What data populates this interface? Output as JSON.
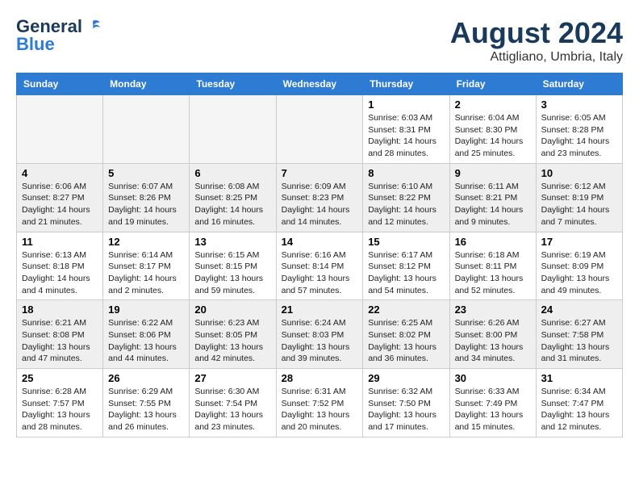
{
  "header": {
    "logo_general": "General",
    "logo_blue": "Blue",
    "month_title": "August 2024",
    "location": "Attigliano, Umbria, Italy"
  },
  "days_of_week": [
    "Sunday",
    "Monday",
    "Tuesday",
    "Wednesday",
    "Thursday",
    "Friday",
    "Saturday"
  ],
  "weeks": [
    {
      "shaded": false,
      "days": [
        {
          "num": "",
          "info": ""
        },
        {
          "num": "",
          "info": ""
        },
        {
          "num": "",
          "info": ""
        },
        {
          "num": "",
          "info": ""
        },
        {
          "num": "1",
          "info": "Sunrise: 6:03 AM\nSunset: 8:31 PM\nDaylight: 14 hours\nand 28 minutes."
        },
        {
          "num": "2",
          "info": "Sunrise: 6:04 AM\nSunset: 8:30 PM\nDaylight: 14 hours\nand 25 minutes."
        },
        {
          "num": "3",
          "info": "Sunrise: 6:05 AM\nSunset: 8:28 PM\nDaylight: 14 hours\nand 23 minutes."
        }
      ]
    },
    {
      "shaded": true,
      "days": [
        {
          "num": "4",
          "info": "Sunrise: 6:06 AM\nSunset: 8:27 PM\nDaylight: 14 hours\nand 21 minutes."
        },
        {
          "num": "5",
          "info": "Sunrise: 6:07 AM\nSunset: 8:26 PM\nDaylight: 14 hours\nand 19 minutes."
        },
        {
          "num": "6",
          "info": "Sunrise: 6:08 AM\nSunset: 8:25 PM\nDaylight: 14 hours\nand 16 minutes."
        },
        {
          "num": "7",
          "info": "Sunrise: 6:09 AM\nSunset: 8:23 PM\nDaylight: 14 hours\nand 14 minutes."
        },
        {
          "num": "8",
          "info": "Sunrise: 6:10 AM\nSunset: 8:22 PM\nDaylight: 14 hours\nand 12 minutes."
        },
        {
          "num": "9",
          "info": "Sunrise: 6:11 AM\nSunset: 8:21 PM\nDaylight: 14 hours\nand 9 minutes."
        },
        {
          "num": "10",
          "info": "Sunrise: 6:12 AM\nSunset: 8:19 PM\nDaylight: 14 hours\nand 7 minutes."
        }
      ]
    },
    {
      "shaded": false,
      "days": [
        {
          "num": "11",
          "info": "Sunrise: 6:13 AM\nSunset: 8:18 PM\nDaylight: 14 hours\nand 4 minutes."
        },
        {
          "num": "12",
          "info": "Sunrise: 6:14 AM\nSunset: 8:17 PM\nDaylight: 14 hours\nand 2 minutes."
        },
        {
          "num": "13",
          "info": "Sunrise: 6:15 AM\nSunset: 8:15 PM\nDaylight: 13 hours\nand 59 minutes."
        },
        {
          "num": "14",
          "info": "Sunrise: 6:16 AM\nSunset: 8:14 PM\nDaylight: 13 hours\nand 57 minutes."
        },
        {
          "num": "15",
          "info": "Sunrise: 6:17 AM\nSunset: 8:12 PM\nDaylight: 13 hours\nand 54 minutes."
        },
        {
          "num": "16",
          "info": "Sunrise: 6:18 AM\nSunset: 8:11 PM\nDaylight: 13 hours\nand 52 minutes."
        },
        {
          "num": "17",
          "info": "Sunrise: 6:19 AM\nSunset: 8:09 PM\nDaylight: 13 hours\nand 49 minutes."
        }
      ]
    },
    {
      "shaded": true,
      "days": [
        {
          "num": "18",
          "info": "Sunrise: 6:21 AM\nSunset: 8:08 PM\nDaylight: 13 hours\nand 47 minutes."
        },
        {
          "num": "19",
          "info": "Sunrise: 6:22 AM\nSunset: 8:06 PM\nDaylight: 13 hours\nand 44 minutes."
        },
        {
          "num": "20",
          "info": "Sunrise: 6:23 AM\nSunset: 8:05 PM\nDaylight: 13 hours\nand 42 minutes."
        },
        {
          "num": "21",
          "info": "Sunrise: 6:24 AM\nSunset: 8:03 PM\nDaylight: 13 hours\nand 39 minutes."
        },
        {
          "num": "22",
          "info": "Sunrise: 6:25 AM\nSunset: 8:02 PM\nDaylight: 13 hours\nand 36 minutes."
        },
        {
          "num": "23",
          "info": "Sunrise: 6:26 AM\nSunset: 8:00 PM\nDaylight: 13 hours\nand 34 minutes."
        },
        {
          "num": "24",
          "info": "Sunrise: 6:27 AM\nSunset: 7:58 PM\nDaylight: 13 hours\nand 31 minutes."
        }
      ]
    },
    {
      "shaded": false,
      "days": [
        {
          "num": "25",
          "info": "Sunrise: 6:28 AM\nSunset: 7:57 PM\nDaylight: 13 hours\nand 28 minutes."
        },
        {
          "num": "26",
          "info": "Sunrise: 6:29 AM\nSunset: 7:55 PM\nDaylight: 13 hours\nand 26 minutes."
        },
        {
          "num": "27",
          "info": "Sunrise: 6:30 AM\nSunset: 7:54 PM\nDaylight: 13 hours\nand 23 minutes."
        },
        {
          "num": "28",
          "info": "Sunrise: 6:31 AM\nSunset: 7:52 PM\nDaylight: 13 hours\nand 20 minutes."
        },
        {
          "num": "29",
          "info": "Sunrise: 6:32 AM\nSunset: 7:50 PM\nDaylight: 13 hours\nand 17 minutes."
        },
        {
          "num": "30",
          "info": "Sunrise: 6:33 AM\nSunset: 7:49 PM\nDaylight: 13 hours\nand 15 minutes."
        },
        {
          "num": "31",
          "info": "Sunrise: 6:34 AM\nSunset: 7:47 PM\nDaylight: 13 hours\nand 12 minutes."
        }
      ]
    }
  ]
}
